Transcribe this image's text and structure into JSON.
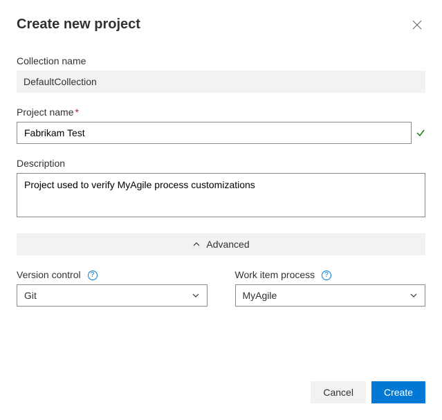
{
  "dialog": {
    "title": "Create new project"
  },
  "fields": {
    "collection": {
      "label": "Collection name",
      "value": "DefaultCollection"
    },
    "projectName": {
      "label": "Project name",
      "value": "Fabrikam Test"
    },
    "description": {
      "label": "Description",
      "value": "Project used to verify MyAgile process customizations"
    },
    "advanced": {
      "label": "Advanced"
    },
    "versionControl": {
      "label": "Version control",
      "value": "Git"
    },
    "workItemProcess": {
      "label": "Work item process",
      "value": "MyAgile"
    }
  },
  "buttons": {
    "cancel": "Cancel",
    "create": "Create"
  }
}
